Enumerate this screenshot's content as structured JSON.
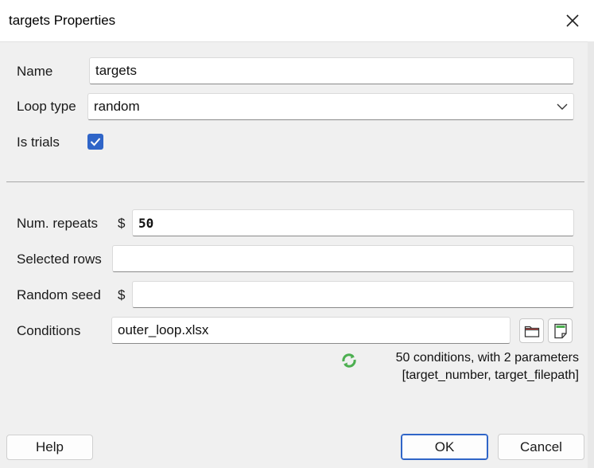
{
  "window": {
    "title": "targets Properties"
  },
  "form": {
    "name": {
      "label": "Name",
      "value": "targets"
    },
    "loop_type": {
      "label": "Loop type",
      "value": "random"
    },
    "is_trials": {
      "label": "Is trials",
      "checked": true
    },
    "num_repeats": {
      "label": "Num. repeats",
      "dollar": "$",
      "value": "50"
    },
    "selected_rows": {
      "label": "Selected rows",
      "value": ""
    },
    "random_seed": {
      "label": "Random seed",
      "dollar": "$",
      "value": ""
    },
    "conditions": {
      "label": "Conditions",
      "value": "outer_loop.xlsx"
    }
  },
  "conditions_info": {
    "line1": "50 conditions, with 2 parameters",
    "line2": "[target_number, target_filepath]"
  },
  "buttons": {
    "help": "Help",
    "ok": "OK",
    "cancel": "Cancel"
  },
  "colors": {
    "accent": "#2f65c8",
    "refresh_icon": "#4caf50"
  },
  "icons": {
    "close": "close-icon",
    "dropdown": "chevron-down-icon",
    "checkbox": "checkmark-icon",
    "browse": "folder-icon",
    "edit": "edit-document-icon",
    "refresh": "refresh-icon"
  }
}
